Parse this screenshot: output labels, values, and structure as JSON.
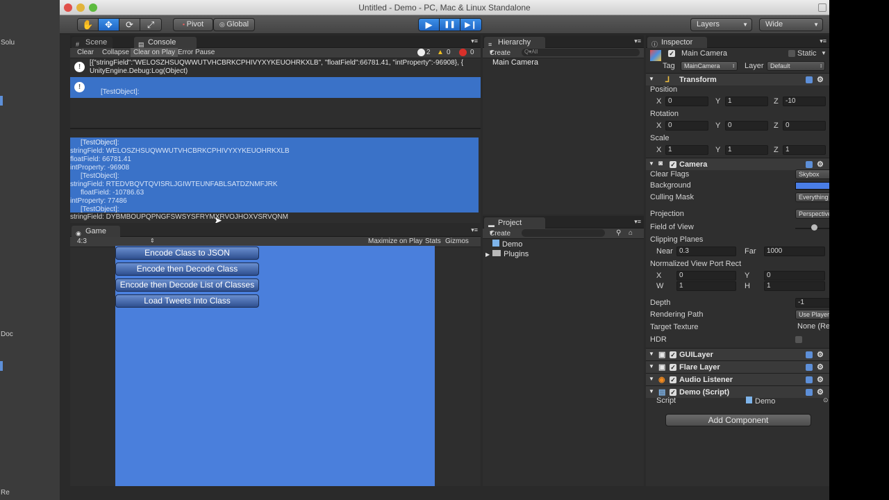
{
  "window": {
    "title": "Untitled - Demo - PC, Mac & Linux Standalone"
  },
  "toolbar": {
    "pivot": "Pivot",
    "global": "Global",
    "layers": "Layers",
    "layout": "Wide"
  },
  "left_strip": {
    "fragments": [
      "Solu",
      "Doc",
      "Re"
    ]
  },
  "console": {
    "tab_scene": "Scene",
    "tab_console": "Console",
    "buttons": [
      "Clear",
      "Collapse",
      "Clear on Play",
      "Error Pause"
    ],
    "counts": {
      "info": "2",
      "warn": "0",
      "error": "0"
    },
    "entries": [
      {
        "line1": "[{\"stringField\":\"WELOSZHSUQWWUTVHCBRKCPHIVYXYKEUOHRKXLB\", \"floatField\":66781.41, \"intProperty\":-96908}, {",
        "line2": "UnityEngine.Debug:Log(Object)"
      },
      {
        "line1": "[TestObject]:"
      }
    ],
    "detail": [
      "[TestObject]:",
      "stringField: WELOSZHSUQWWUTVHCBRKCPHIVYXYKEUOHRKXLB",
      "floatField: 66781.41",
      "intProperty: -96908",
      "[TestObject]:",
      "stringField: RTEDVBQVTQVISRLJGIWTEUNFABLSATDZNMFJRK",
      "floatField: -10786.63",
      "intProperty: 77486",
      "[TestObject]:",
      "stringField: DYBMBOUPQPNGFSWSYSFRYMXRVOJHOXVSRVQNM"
    ]
  },
  "game": {
    "tab": "Game",
    "aspect": "4:3",
    "toggles": [
      "Maximize on Play",
      "Stats",
      "Gizmos"
    ],
    "buttons": [
      "Encode Class to JSON",
      "Encode then Decode Class",
      "Encode then Decode List of Classes",
      "Load Tweets Into Class"
    ]
  },
  "hierarchy": {
    "tab": "Hierarchy",
    "create": "Create",
    "search_placeholder": "Q▾All",
    "items": [
      "Main Camera"
    ]
  },
  "project": {
    "tab": "Project",
    "create": "Create",
    "items": [
      "Demo",
      "Plugins"
    ]
  },
  "inspector": {
    "tab": "Inspector",
    "object_name": "Main Camera",
    "static_label": "Static",
    "tag_label": "Tag",
    "tag_value": "MainCamera",
    "layer_label": "Layer",
    "layer_value": "Default",
    "transform": {
      "title": "Transform",
      "position_label": "Position",
      "position": {
        "x": "0",
        "y": "1",
        "z": "-10"
      },
      "rotation_label": "Rotation",
      "rotation": {
        "x": "0",
        "y": "0",
        "z": "0"
      },
      "scale_label": "Scale",
      "scale": {
        "x": "1",
        "y": "1",
        "z": "1"
      }
    },
    "camera": {
      "title": "Camera",
      "clear_flags_label": "Clear Flags",
      "clear_flags": "Skybox",
      "background_label": "Background",
      "background_color": "#4a7ee6",
      "culling_mask_label": "Culling Mask",
      "culling_mask": "Everything",
      "projection_label": "Projection",
      "projection": "Perspective",
      "fov_label": "Field of View",
      "fov": "60",
      "clipping_label": "Clipping Planes",
      "near_label": "Near",
      "near": "0.3",
      "far_label": "Far",
      "far": "1000",
      "viewport_label": "Normalized View Port Rect",
      "vp_x": "0",
      "vp_y": "0",
      "vp_w": "1",
      "vp_h": "1",
      "depth_label": "Depth",
      "depth": "-1",
      "rendering_label": "Rendering Path",
      "rendering": "Use Player Settings",
      "target_label": "Target Texture",
      "target": "None (Render Texture)",
      "hdr_label": "HDR"
    },
    "components": [
      "GUILayer",
      "Flare Layer",
      "Audio Listener",
      "Demo (Script)"
    ],
    "script_label": "Script",
    "script_value": "Demo",
    "add_component": "Add Component"
  },
  "axis": {
    "x": "X",
    "y": "Y",
    "z": "Z",
    "w": "W",
    "h": "H"
  }
}
